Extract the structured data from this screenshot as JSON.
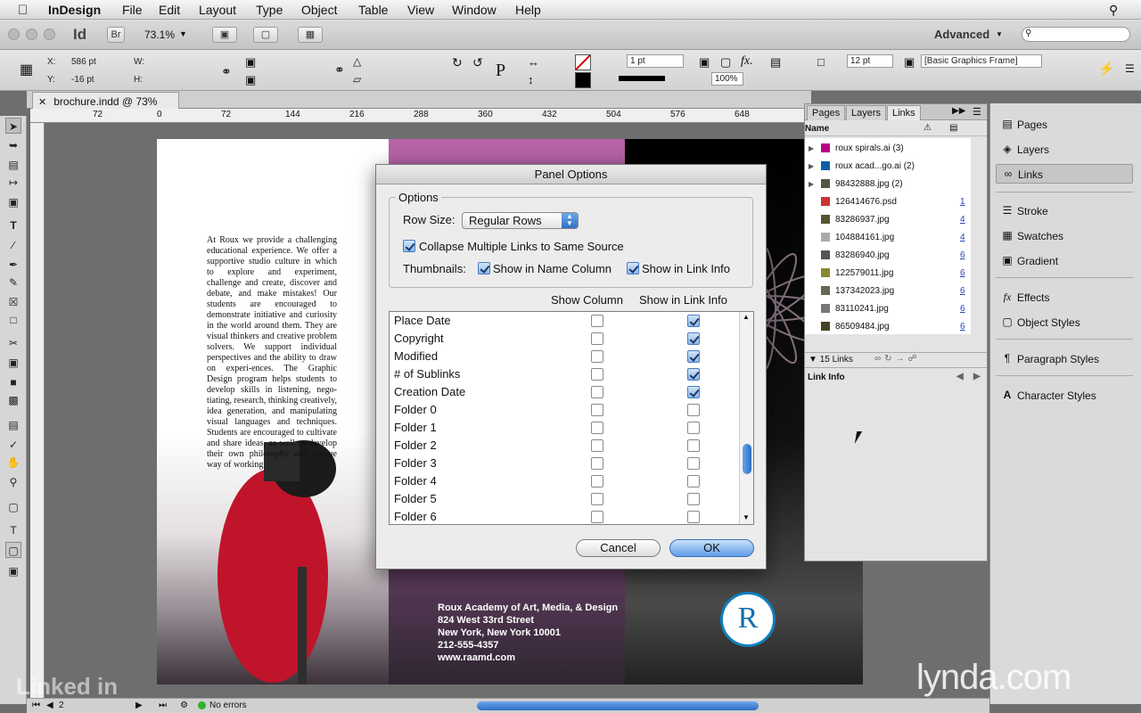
{
  "menubar": {
    "app": "InDesign",
    "items": [
      "File",
      "Edit",
      "Layout",
      "Type",
      "Object",
      "Table",
      "View",
      "Window",
      "Help"
    ]
  },
  "appbar": {
    "app_icon": "Id",
    "bridge": "Br",
    "zoom": "73.1%",
    "workspace": "Advanced"
  },
  "control": {
    "x_label": "X:",
    "x_value": "586 pt",
    "y_label": "Y:",
    "y_value": "-16 pt",
    "w_label": "W:",
    "h_label": "H:",
    "stroke_weight": "1 pt",
    "percent": "100%",
    "gap": "12 pt",
    "frame_style": "[Basic Graphics Frame]"
  },
  "document": {
    "tab_title": "brochure.indd @ 73%",
    "ruler_ticks": [
      "72",
      "0",
      "72",
      "144",
      "216",
      "288",
      "360",
      "432",
      "504",
      "576",
      "648"
    ],
    "body_text": "At Roux we provide a challenging educational experience. We offer a supportive studio culture in which to explore and experiment, challenge and create, discover and debate, and make mistakes! Our students are encouraged to demonstrate initiative and curiosity in the world around them. They are visual thinkers and creative problem solvers. We support individual perspectives and the ability to draw on experi-ences. The Graphic Design program helps students to develop skills in listening, nego-tiating, research, thinking creatively, idea generation, and manipulating visual languages and techniques. Students are encouraged to cultivate and share ideas, as well as develop their own philosophy and unique way of working.",
    "address": [
      "Roux Academy of Art, Media, & Design",
      "824 West 33rd Street",
      "New York, New York 10001",
      "212-555-4357",
      "www.raamd.com"
    ],
    "logo_letter": "R"
  },
  "dialog": {
    "title": "Panel Options",
    "options_label": "Options",
    "row_size_label": "Row Size:",
    "row_size_value": "Regular Rows",
    "collapse_label": "Collapse Multiple Links to Same Source",
    "thumbnails_label": "Thumbnails:",
    "thumb_name_label": "Show in Name Column",
    "thumb_info_label": "Show in Link Info",
    "col_header_1": "Show Column",
    "col_header_2": "Show in Link Info",
    "rows": [
      {
        "name": "Place Date",
        "show_column": false,
        "show_info": true
      },
      {
        "name": "Copyright",
        "show_column": false,
        "show_info": true
      },
      {
        "name": "Modified",
        "show_column": false,
        "show_info": true
      },
      {
        "name": "# of Sublinks",
        "show_column": false,
        "show_info": true
      },
      {
        "name": "Creation Date",
        "show_column": false,
        "show_info": true
      },
      {
        "name": "Folder 0",
        "show_column": false,
        "show_info": false
      },
      {
        "name": "Folder 1",
        "show_column": false,
        "show_info": false
      },
      {
        "name": "Folder 2",
        "show_column": false,
        "show_info": false
      },
      {
        "name": "Folder 3",
        "show_column": false,
        "show_info": false
      },
      {
        "name": "Folder 4",
        "show_column": false,
        "show_info": false
      },
      {
        "name": "Folder 5",
        "show_column": false,
        "show_info": false
      },
      {
        "name": "Folder 6",
        "show_column": false,
        "show_info": false
      }
    ],
    "cancel": "Cancel",
    "ok": "OK"
  },
  "links_panel": {
    "tabs": [
      "Pages",
      "Layers",
      "Links"
    ],
    "name_header": "Name",
    "items": [
      {
        "name": "roux spirals.ai (3)",
        "page": ""
      },
      {
        "name": "roux acad...go.ai (2)",
        "page": ""
      },
      {
        "name": "98432888.jpg (2)",
        "page": ""
      },
      {
        "name": "126414676.psd",
        "page": "1"
      },
      {
        "name": "83286937.jpg",
        "page": "4"
      },
      {
        "name": "104884161.jpg",
        "page": "4"
      },
      {
        "name": "83286940.jpg",
        "page": "6"
      },
      {
        "name": "122579011.jpg",
        "page": "6"
      },
      {
        "name": "137342023.jpg",
        "page": "6"
      },
      {
        "name": "83110241.jpg",
        "page": "6"
      },
      {
        "name": "86509484.jpg",
        "page": "6"
      }
    ],
    "count": "15 Links",
    "link_info": "Link Info"
  },
  "dock": {
    "items": [
      "Pages",
      "Layers",
      "Links",
      "Stroke",
      "Swatches",
      "Gradient",
      "Effects",
      "Object Styles",
      "Paragraph Styles",
      "Character Styles"
    ]
  },
  "statusbar": {
    "page": "2",
    "errors": "No errors"
  },
  "watermarks": {
    "lynda": "lynda.com",
    "linkedin": "Linked in"
  }
}
